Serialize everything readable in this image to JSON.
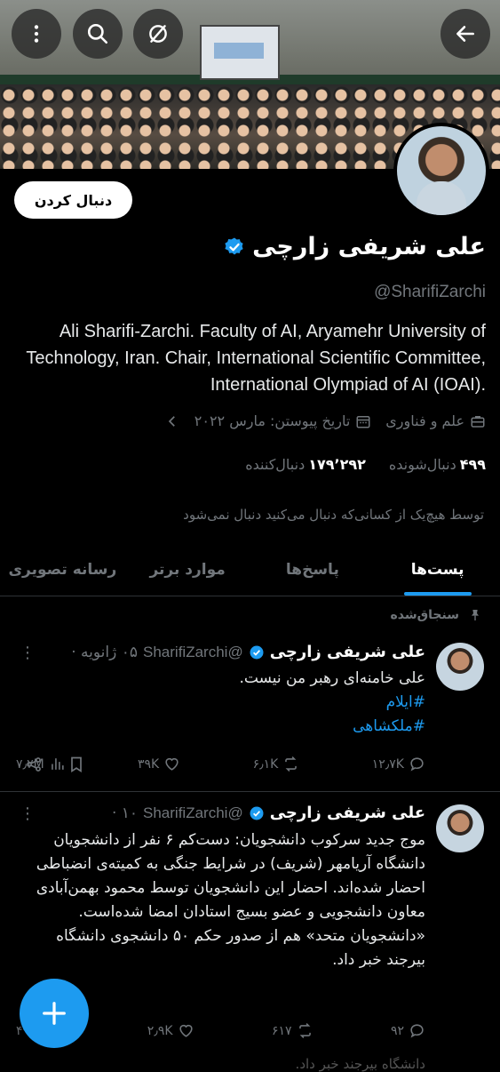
{
  "header": {
    "back_icon": "arrow-left-icon",
    "more_icon": "more-vertical-icon",
    "search_icon": "search-icon",
    "grok_icon": "slash-circle-icon"
  },
  "profile": {
    "follow_label": "دنبال کردن",
    "name": "علی شریفی زارچی",
    "handle": "@SharifiZarchi",
    "bio": "Ali Sharifi-Zarchi. Faculty of AI, Aryamehr University of Technology, Iran. Chair, International Scientific Committee, International Olympiad of AI (IOAI).",
    "category": "علم و فناوری",
    "joined": "تاریخ پیوستن: مارس ۲۰۲۲",
    "following_count": "۴۹۹",
    "following_label": "دنبال‌شونده",
    "followers_count": "۱۷۹٬۲۹۲",
    "followers_label": "دنبال‌کننده",
    "followed_by_note": "توسط هیچ‌یک از کسانی‌که دنبال می‌کنید دنبال نمی‌شود",
    "verified_color": "#1d9bf0"
  },
  "tabs": [
    "پست‌ها",
    "پاسخ‌ها",
    "موارد برتر",
    "رسانه تصویری"
  ],
  "active_tab": "پست‌ها",
  "pinned_label": "سنجاق‌شده",
  "posts": [
    {
      "name": "علی شریفی زارچی",
      "handle": "@SharifiZarchi",
      "time": "۰۵ ژانویه ·",
      "text": "علی خامنه‌ای رهبر من نیست.",
      "hashtags": [
        "#ایلام",
        "#ملکشاهی"
      ],
      "replies": "۱۲٫۷K",
      "reposts": "۶٫۱K",
      "likes": "۳۹K",
      "views": "۷٫۲M"
    },
    {
      "name": "علی شریفی زارچی",
      "handle": "@SharifiZarchi",
      "time": "۱۰ ·",
      "text": "موج جدید سرکوب دانشجویان: دست‌کم ۶ نفر از دانشجویان دانشگاه آریامهر (شریف) در شرایط جنگی به کمیته‌ی انضباطی احضار شده‌اند. احضار این دانشجویان توسط محمود بهمن‌آبادی معاون دانشجویی و عضو بسیج استادان امضا شده‌است.",
      "text2": "«دانشجویان متحد» هم از صدور حکم ۵۰ دانشجوی دانشگاه بیرجند خبر داد.",
      "replies": "۹۲",
      "reposts": "۶۱۷",
      "likes": "۲٫۹K",
      "views": "۴۹٫۳K"
    }
  ],
  "cut_text": "دانشگاه بیرجند خبر داد."
}
